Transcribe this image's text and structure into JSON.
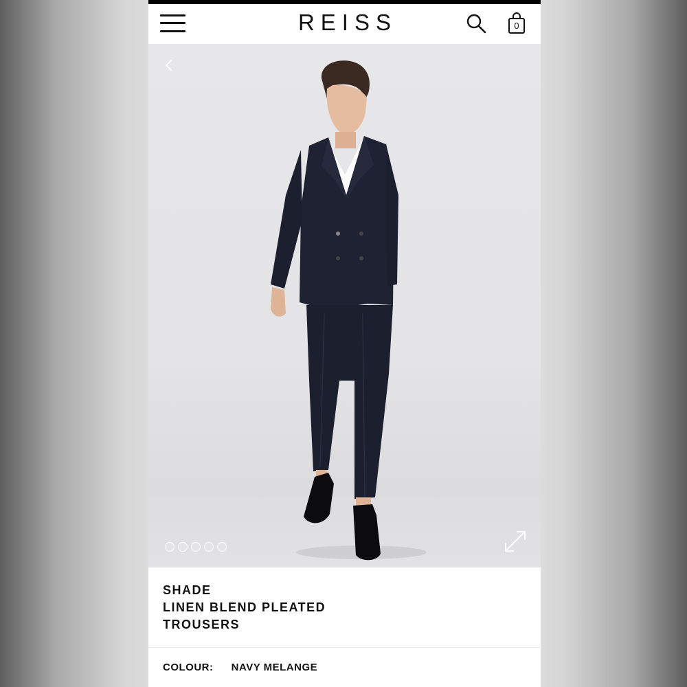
{
  "header": {
    "logo": "REISS",
    "bag_count": "0",
    "icons": [
      "menu-icon",
      "search-icon",
      "shopping-bag-icon"
    ]
  },
  "gallery": {
    "image_count": 5,
    "current_image": 1,
    "icons": [
      "chevron-left-icon",
      "expand-icon"
    ]
  },
  "product": {
    "brand": "SHADE",
    "name": "LINEN BLEND PLEATED TROUSERS",
    "colour_label": "COLOUR:",
    "colour_value": "NAVY MELANGE"
  },
  "colors": {
    "background": "#ffffff",
    "text": "#111111",
    "suit": "#1c1f2e",
    "backdrop": "#e5e5e7"
  }
}
